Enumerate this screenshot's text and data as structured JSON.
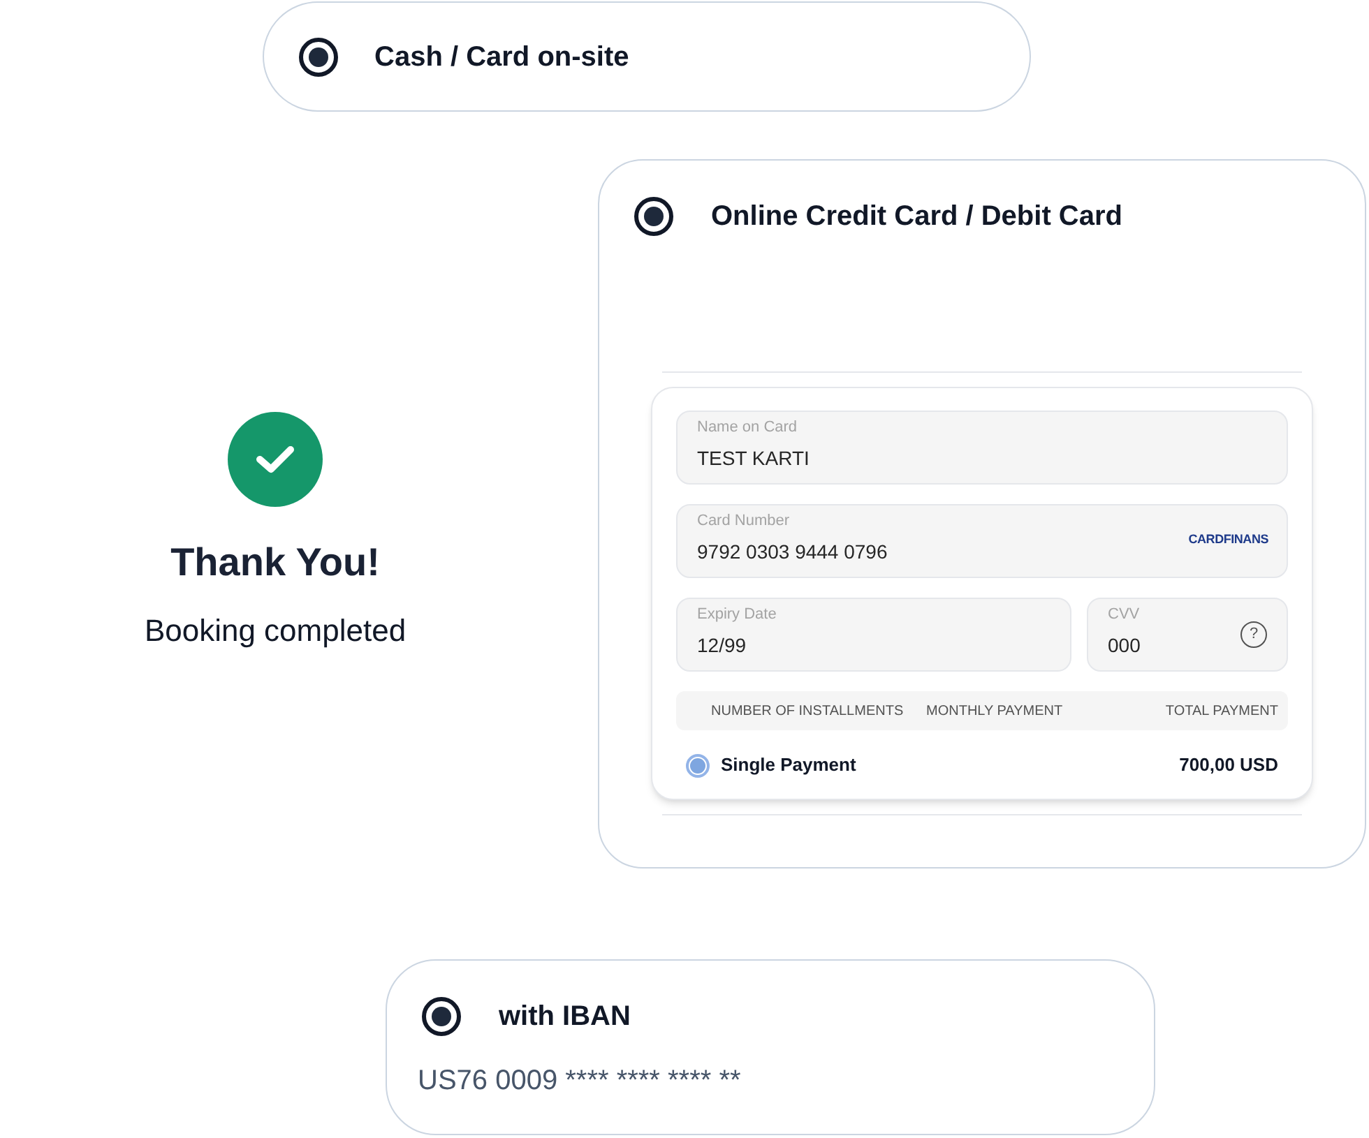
{
  "payment_options": [
    {
      "kind": "cash",
      "label": "Cash / Card on-site",
      "selected": true
    },
    {
      "kind": "online",
      "label": "Online Credit Card / Debit Card",
      "selected": true
    },
    {
      "kind": "iban",
      "label": "with IBAN",
      "selected": true,
      "iban": "US76 0009 **** **** **** **"
    }
  ],
  "confirmation": {
    "title": "Thank You!",
    "message": "Booking completed"
  },
  "card_form": {
    "fields": [
      {
        "kind": "name",
        "label": "Name on Card",
        "value": "TEST KARTI"
      },
      {
        "kind": "number",
        "label": "Card Number",
        "value": "9792 0303 9444 0796",
        "logo_text": "CARDFINANS"
      },
      {
        "kind": "expiry",
        "label": "Expiry Date",
        "value": "12/99"
      },
      {
        "kind": "cvv",
        "label": "CVV",
        "value": "000",
        "help": "?"
      }
    ],
    "installments": {
      "columns": [
        "NUMBER OF INSTALLMENTS",
        "MONTHLY PAYMENT",
        "TOTAL PAYMENT"
      ],
      "rows": [
        {
          "label": "Single Payment",
          "total": "700,00 USD",
          "selected": true
        }
      ]
    }
  }
}
